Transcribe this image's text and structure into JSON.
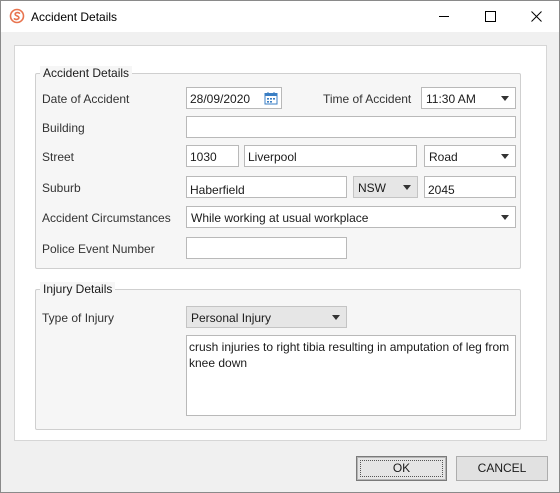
{
  "window": {
    "title": "Accident Details",
    "brand_color": "#e8744f"
  },
  "accident": {
    "group_title": "Accident Details",
    "date_label": "Date of Accident",
    "date_value": "28/09/2020",
    "time_label": "Time of Accident",
    "time_value": "11:30 AM",
    "building_label": "Building",
    "building_value": "",
    "street_label": "Street",
    "street_number": "1030",
    "street_name": "Liverpool",
    "street_type": "Road",
    "suburb_label": "Suburb",
    "suburb_value": "Haberfield",
    "state_value": "NSW",
    "postcode_value": "2045",
    "circumstances_label": "Accident Circumstances",
    "circumstances_value": "While working at usual workplace",
    "police_label": "Police Event Number",
    "police_value": ""
  },
  "injury": {
    "group_title": "Injury Details",
    "type_label": "Type of Injury",
    "type_value": "Personal Injury",
    "description": "crush injuries to right tibia resulting in amputation of leg from knee down"
  },
  "buttons": {
    "ok": "OK",
    "cancel": "CANCEL"
  }
}
